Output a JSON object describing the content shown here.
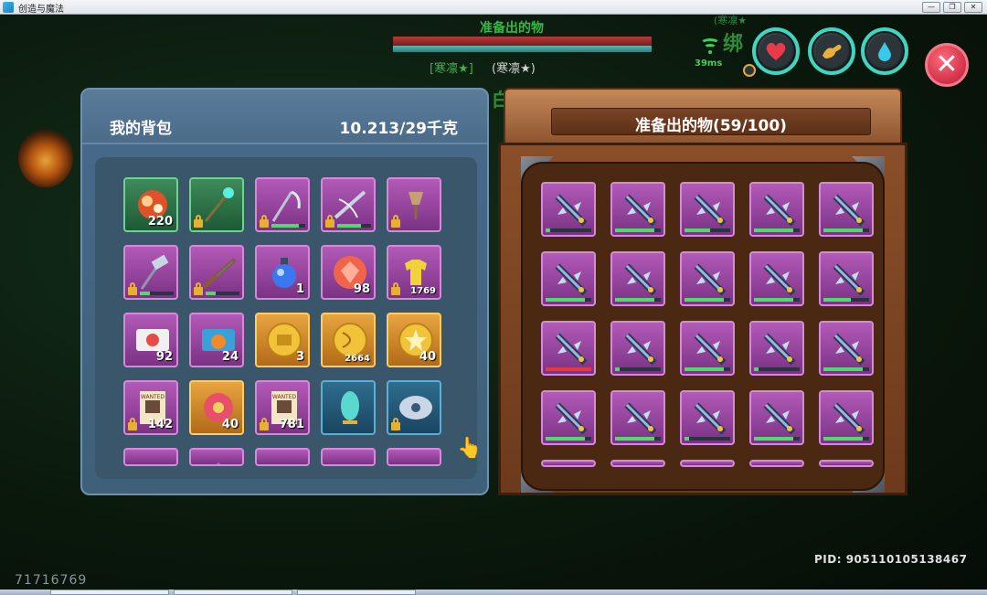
{
  "window": {
    "title": "创造与魔法",
    "minimize_label": "—",
    "maximize_label": "❐",
    "close_label": "✕"
  },
  "hud": {
    "target_name": "准备出的物",
    "tag_left": "[寒凛★]",
    "tag_right": "(寒凛★)",
    "bg_text_1": "(寒凛★",
    "bg_text_2": "绑",
    "bg_text_3": "白",
    "ping": "39ms",
    "stat_buttons": [
      "heart-icon",
      "strength-icon",
      "water-drop-icon"
    ],
    "close_label": "✕",
    "colors": {
      "accent": "#3ed6c0",
      "close": "#e0455a",
      "hp": "#b63a3a"
    }
  },
  "backpack": {
    "title": "我的背包",
    "weight": "10.213/29千克",
    "items": [
      {
        "icon": "ore-chunk",
        "style": "green",
        "count": "220",
        "lock": false
      },
      {
        "icon": "magic-staff",
        "style": "green",
        "count": "",
        "lock": true
      },
      {
        "icon": "ice-scythe",
        "style": "purple",
        "count": "",
        "lock": true,
        "durability": 0.8
      },
      {
        "icon": "ice-crossbow",
        "style": "purple",
        "count": "",
        "lock": true,
        "durability": 0.7
      },
      {
        "icon": "goblet-weapon",
        "style": "purple",
        "count": "",
        "lock": true
      },
      {
        "icon": "ice-hammer",
        "style": "purple",
        "count": "",
        "lock": true,
        "durability": 0.3
      },
      {
        "icon": "rifle",
        "style": "purple",
        "count": "",
        "lock": true,
        "durability": 0.3
      },
      {
        "icon": "blue-potion",
        "style": "purple",
        "count": "1",
        "lock": false
      },
      {
        "icon": "red-gem-coin",
        "style": "purple",
        "count": "98",
        "lock": false
      },
      {
        "icon": "gold-shirt",
        "style": "purple",
        "count": "1769",
        "lock": true
      },
      {
        "icon": "red-ticket",
        "style": "purple",
        "count": "92",
        "lock": false
      },
      {
        "icon": "pumpkin-ticket",
        "style": "purple",
        "count": "24",
        "lock": false
      },
      {
        "icon": "gold-coin-chest",
        "style": "gold",
        "count": "3",
        "lock": false
      },
      {
        "icon": "gold-coin-bow",
        "style": "gold",
        "count": "2664",
        "lock": false
      },
      {
        "icon": "gold-coin-star",
        "style": "gold",
        "count": "40",
        "lock": false
      },
      {
        "icon": "wanted-poster",
        "style": "purple",
        "count": "142",
        "lock": true
      },
      {
        "icon": "red-flower",
        "style": "gold",
        "count": "40",
        "lock": false
      },
      {
        "icon": "wanted-poster",
        "style": "purple",
        "count": "781",
        "lock": true
      },
      {
        "icon": "teal-mirror",
        "style": "blue",
        "count": "",
        "lock": false
      },
      {
        "icon": "disc-shield",
        "style": "blue",
        "count": "",
        "lock": true
      },
      {
        "icon": "white-stone",
        "style": "purple",
        "count": "",
        "lock": false
      },
      {
        "icon": "purple-crystal",
        "style": "purple",
        "count": "",
        "lock": false
      },
      {
        "icon": "scroll",
        "style": "purple",
        "count": "",
        "lock": false
      },
      {
        "icon": "sand-stone",
        "style": "purple",
        "count": "",
        "lock": false
      },
      {
        "icon": "blue-orb",
        "style": "purple",
        "count": "",
        "lock": false
      }
    ]
  },
  "chest": {
    "title": "准备出的物(59/100)",
    "items": [
      {
        "icon": "ice-sword",
        "durability": 0.1
      },
      {
        "icon": "ice-sword",
        "durability": 0.85
      },
      {
        "icon": "ice-sword",
        "durability": 0.55
      },
      {
        "icon": "ice-sword",
        "durability": 0.85
      },
      {
        "icon": "ice-sword",
        "durability": 0.85
      },
      {
        "icon": "ice-sword",
        "durability": 0.85
      },
      {
        "icon": "ice-sword",
        "durability": 0.85
      },
      {
        "icon": "ice-sword",
        "durability": 0.85
      },
      {
        "icon": "ice-sword",
        "durability": 0.85
      },
      {
        "icon": "ice-sword",
        "durability": 0.6
      },
      {
        "icon": "ice-sword",
        "durability": 1.0,
        "red": true
      },
      {
        "icon": "ice-sword",
        "durability": 0.1
      },
      {
        "icon": "ice-sword",
        "durability": 0.85
      },
      {
        "icon": "ice-sword",
        "durability": 0.1
      },
      {
        "icon": "ice-sword",
        "durability": 0.85
      },
      {
        "icon": "ice-sword",
        "durability": 0.85
      },
      {
        "icon": "ice-sword",
        "durability": 0.85
      },
      {
        "icon": "ice-sword",
        "durability": 0.1
      },
      {
        "icon": "ice-sword",
        "durability": 0.85
      },
      {
        "icon": "ice-sword",
        "durability": 0.85
      },
      {
        "icon": "ice-sword",
        "durability": 0
      },
      {
        "icon": "ice-sword",
        "durability": 0
      },
      {
        "icon": "ice-sword",
        "durability": 0
      },
      {
        "icon": "ice-sword",
        "durability": 0
      },
      {
        "icon": "ice-sword",
        "durability": 0
      }
    ]
  },
  "footer": {
    "pid": "PID: 905110105138467",
    "uid": "71716769"
  }
}
